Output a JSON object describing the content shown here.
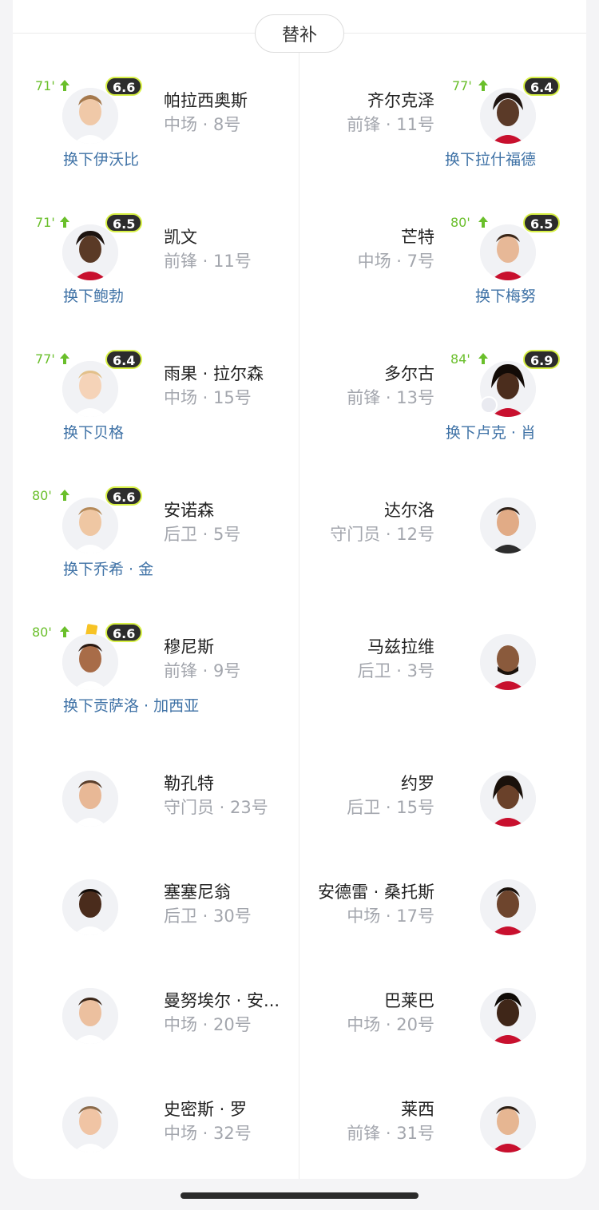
{
  "section": {
    "title": "替补"
  },
  "home": [
    {
      "name": "帕拉西奥斯",
      "meta": "中场 · 8号",
      "minute": "71'",
      "rating": "6.6",
      "sub": "换下伊沃比"
    },
    {
      "name": "凯文",
      "meta": "前锋 · 11号",
      "minute": "71'",
      "rating": "6.5",
      "sub": "换下鲍勃"
    },
    {
      "name": "雨果 · 拉尔森",
      "meta": "中场 · 15号",
      "minute": "77'",
      "rating": "6.4",
      "sub": "换下贝格"
    },
    {
      "name": "安诺森",
      "meta": "后卫 · 5号",
      "minute": "80'",
      "rating": "6.6",
      "sub": "换下乔希 · 金"
    },
    {
      "name": "穆尼斯",
      "meta": "前锋 · 9号",
      "minute": "80'",
      "rating": "6.6",
      "sub": "换下贡萨洛 · 加西亚"
    },
    {
      "name": "勒孔特",
      "meta": "守门员 · 23号"
    },
    {
      "name": "塞塞尼翁",
      "meta": "后卫 · 30号"
    },
    {
      "name": "曼努埃尔 · 安...",
      "meta": "中场 · 20号"
    },
    {
      "name": "史密斯 · 罗",
      "meta": "中场 · 32号"
    }
  ],
  "away": [
    {
      "name": "齐尔克泽",
      "meta": "前锋 · 11号",
      "minute": "77'",
      "rating": "6.4",
      "sub": "换下拉什福德"
    },
    {
      "name": "芒特",
      "meta": "中场 · 7号",
      "minute": "80'",
      "rating": "6.5",
      "sub": "换下梅努"
    },
    {
      "name": "多尔古",
      "meta": "前锋 · 13号",
      "minute": "84'",
      "rating": "6.9",
      "sub": "换下卢克 · 肖"
    },
    {
      "name": "达尔洛",
      "meta": "守门员 · 12号"
    },
    {
      "name": "马兹拉维",
      "meta": "后卫 · 3号"
    },
    {
      "name": "约罗",
      "meta": "后卫 · 15号"
    },
    {
      "name": "安德雷 · 桑托斯",
      "meta": "中场 · 17号"
    },
    {
      "name": "巴莱巴",
      "meta": "中场 · 20号"
    },
    {
      "name": "莱西",
      "meta": "前锋 · 31号"
    }
  ],
  "icons": {
    "arrow": "sub-in-arrow-icon",
    "yellow": "yellow-card-icon",
    "avatar": "player-avatar-icon"
  },
  "colors": {
    "rating_bg": "#2c2c2c",
    "rating_ring": "#d7f044",
    "minute": "#6abf2b",
    "sub_link": "#3f72a6"
  }
}
